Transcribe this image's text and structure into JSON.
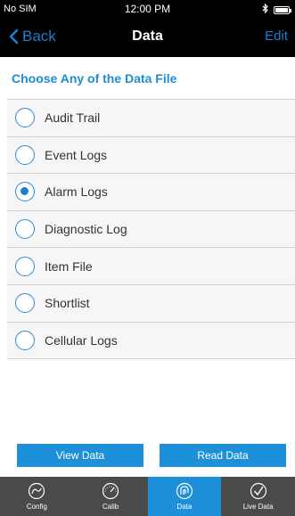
{
  "status": {
    "carrier": "No SIM",
    "time": "12:00 PM",
    "bluetooth_icon": "bluetooth-icon",
    "battery_icon": "battery-icon"
  },
  "nav": {
    "back_label": "Back",
    "title": "Data",
    "edit_label": "Edit"
  },
  "heading": "Choose Any of the Data File",
  "options": [
    {
      "label": "Audit Trail",
      "selected": false
    },
    {
      "label": "Event Logs",
      "selected": false
    },
    {
      "label": "Alarm Logs",
      "selected": true
    },
    {
      "label": "Diagnostic Log",
      "selected": false
    },
    {
      "label": "Item File",
      "selected": false
    },
    {
      "label": "Shortlist",
      "selected": false
    },
    {
      "label": "Cellular Logs",
      "selected": false
    }
  ],
  "buttons": {
    "view": "View Data",
    "read": "Read Data"
  },
  "tabs": [
    {
      "label": "Config",
      "icon": "config-icon",
      "active": false
    },
    {
      "label": "Calib",
      "icon": "gauge-icon",
      "active": false
    },
    {
      "label": "Data",
      "icon": "data-icon",
      "active": true
    },
    {
      "label": "Live Data",
      "icon": "checkmark-circle-icon",
      "active": false
    }
  ],
  "colors": {
    "accent": "#1e8fd9",
    "tabbar": "#4a4a4a",
    "header": "#000000"
  }
}
